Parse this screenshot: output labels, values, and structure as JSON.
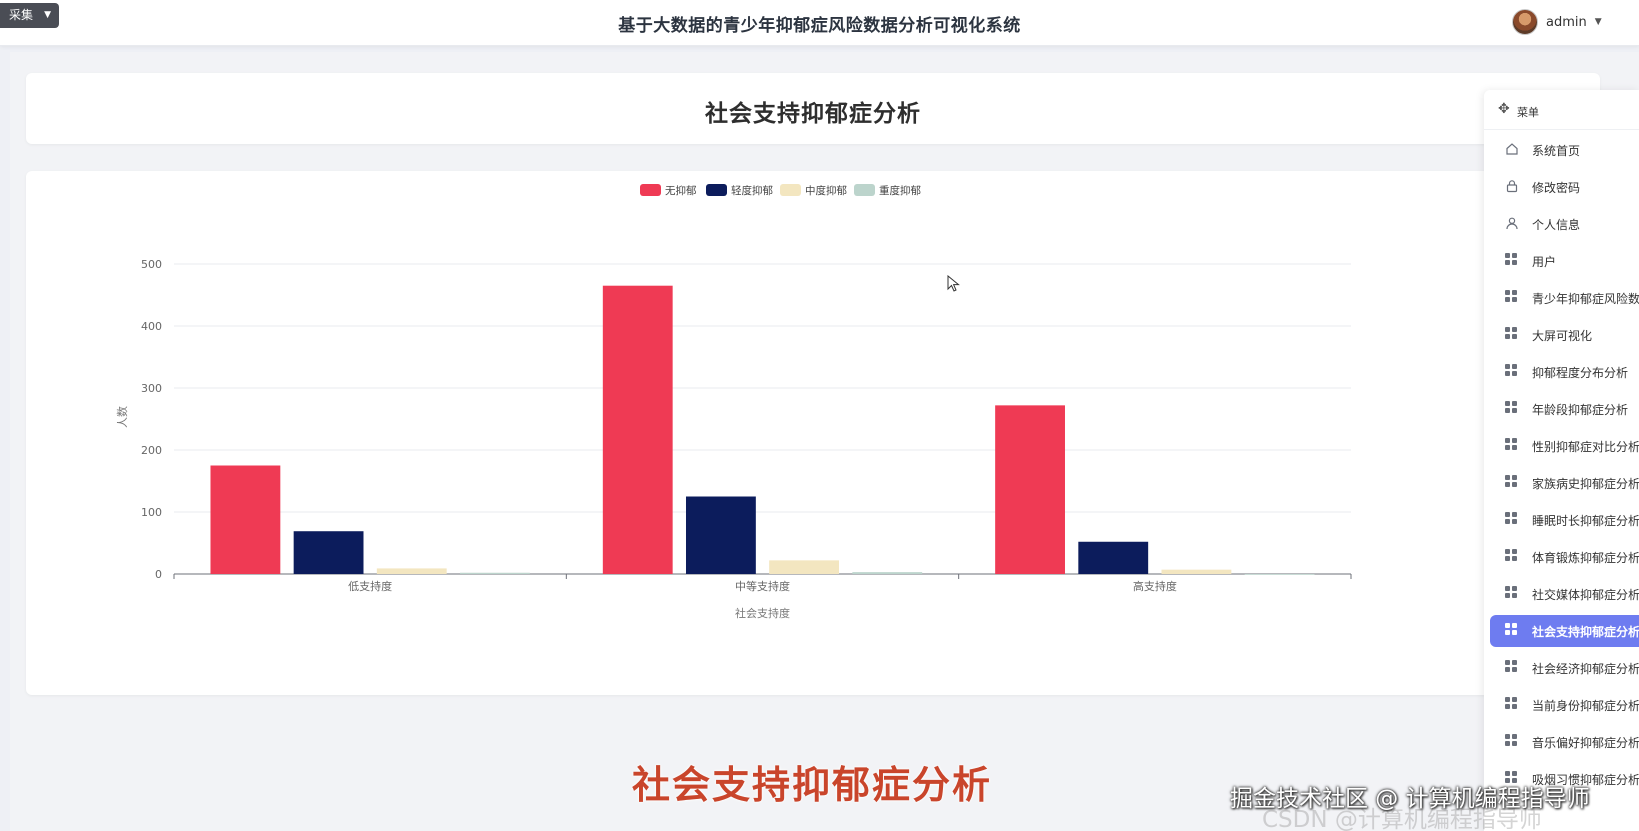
{
  "header": {
    "collect_button": "采集",
    "title": "基于大数据的青少年抑郁症风险数据分析可视化系统",
    "username": "admin"
  },
  "page": {
    "title": "社会支持抑郁症分析"
  },
  "sidebar": {
    "head": "菜单",
    "items": [
      {
        "label": "系统首页",
        "icon": "home-icon"
      },
      {
        "label": "修改密码",
        "icon": "lock-icon"
      },
      {
        "label": "个人信息",
        "icon": "user-icon"
      },
      {
        "label": "用户",
        "icon": "grid-icon"
      },
      {
        "label": "青少年抑郁症风险数",
        "icon": "grid-icon"
      },
      {
        "label": "大屏可视化",
        "icon": "grid-icon"
      },
      {
        "label": "抑郁程度分布分析",
        "icon": "grid-icon"
      },
      {
        "label": "年龄段抑郁症分析",
        "icon": "grid-icon"
      },
      {
        "label": "性别抑郁症对比分析",
        "icon": "grid-icon"
      },
      {
        "label": "家族病史抑郁症分析",
        "icon": "grid-icon"
      },
      {
        "label": "睡眠时长抑郁症分析",
        "icon": "grid-icon"
      },
      {
        "label": "体育锻炼抑郁症分析",
        "icon": "grid-icon"
      },
      {
        "label": "社交媒体抑郁症分析",
        "icon": "grid-icon"
      },
      {
        "label": "社会支持抑郁症分析",
        "icon": "grid-icon",
        "active": true
      },
      {
        "label": "社会经济抑郁症分析",
        "icon": "grid-icon"
      },
      {
        "label": "当前身份抑郁症分析",
        "icon": "grid-icon"
      },
      {
        "label": "音乐偏好抑郁症分析",
        "icon": "grid-icon"
      },
      {
        "label": "吸烟习惯抑郁症分析",
        "icon": "grid-icon"
      }
    ]
  },
  "chart_data": {
    "type": "bar",
    "categories": [
      "低支持度",
      "中等支持度",
      "高支持度"
    ],
    "series": [
      {
        "name": "无抑郁",
        "color": "#ef3a54",
        "values": [
          175,
          465,
          272
        ]
      },
      {
        "name": "轻度抑郁",
        "color": "#0c1c5c",
        "values": [
          69,
          125,
          52
        ]
      },
      {
        "name": "中度抑郁",
        "color": "#f3e6c0",
        "values": [
          9,
          22,
          7
        ]
      },
      {
        "name": "重度抑郁",
        "color": "#bcd4cc",
        "values": [
          2,
          3,
          0
        ]
      }
    ],
    "xlabel": "社会支持度",
    "ylabel": "人数",
    "ylim": [
      0,
      500
    ],
    "yticks": [
      0,
      100,
      200,
      300,
      400,
      500
    ],
    "legend": "top-center",
    "grid": true
  },
  "caption": "社会支持抑郁症分析",
  "watermark": "掘金技术社区 @ 计算机编程指导师",
  "watermark_faint": "CSDN @计算机编程指导师"
}
